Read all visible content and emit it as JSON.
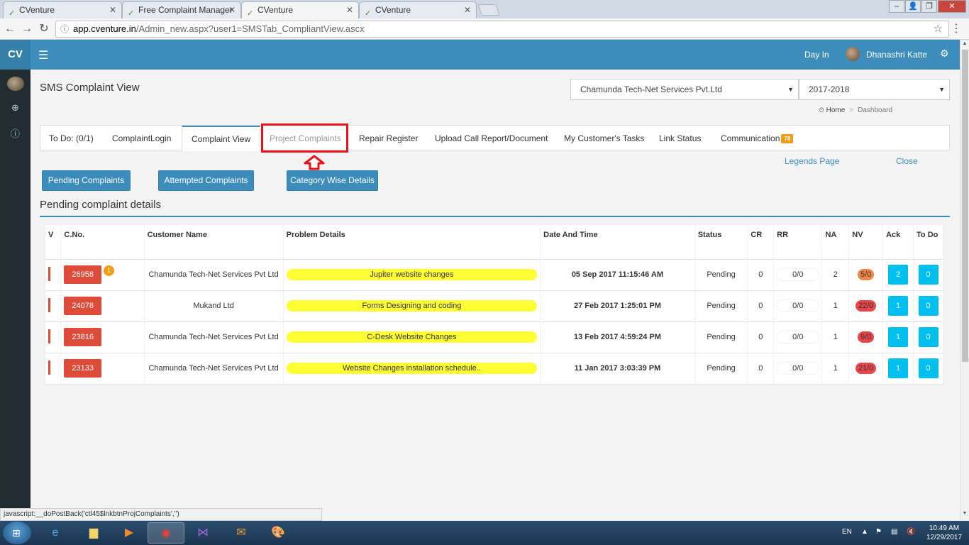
{
  "browser": {
    "tabs": [
      {
        "title": "CVenture"
      },
      {
        "title": "Free Complaint Manager"
      },
      {
        "title": "CVenture"
      },
      {
        "title": "CVenture"
      }
    ],
    "url_host": "app.cventure.in",
    "url_path": "/Admin_new.aspx?user1=SMSTab_CompliantView.ascx",
    "status_text": "javascript:__doPostBack('ctl45$lnkbtnProjComplaints','')"
  },
  "header": {
    "logo": "CV",
    "day_in": "Day In",
    "user_name": "Dhanashri Katte"
  },
  "page": {
    "title": "SMS Complaint View",
    "company_select": "Chamunda Tech-Net Services Pvt.Ltd",
    "year_select": "2017-2018",
    "breadcrumb": {
      "home": "Home",
      "current": "Dashboard"
    }
  },
  "tabs": [
    {
      "label": "To Do: (0/1)"
    },
    {
      "label": "ComplaintLogin"
    },
    {
      "label": "Complaint View"
    },
    {
      "label": "Project Complaints"
    },
    {
      "label": "Repair Register"
    },
    {
      "label": "Upload Call Report/Document"
    },
    {
      "label": "My Customer's Tasks"
    },
    {
      "label": "Link Status"
    },
    {
      "label": "Communication",
      "badge": "78"
    }
  ],
  "links": {
    "legends": "Legends Page",
    "close": "Close"
  },
  "buttons": {
    "pending": "Pending Complaints",
    "attempted": "Attempted Complaints",
    "category": "Category Wise Details"
  },
  "section_title": "Pending complaint details",
  "table": {
    "headers": [
      "V",
      "C.No.",
      "Customer Name",
      "Problem Details",
      "Date And Time",
      "Status",
      "CR",
      "RR",
      "NA",
      "NV",
      "Ack",
      "To Do"
    ],
    "rows": [
      {
        "cno": "26958",
        "badge": "1",
        "customer": "Chamunda Tech-Net Services Pvt Ltd",
        "problem": "Jupiter website changes",
        "datetime": "05 Sep 2017 11:15:46 AM",
        "status": "Pending",
        "cr": "0",
        "rr": "0/0",
        "na": "2",
        "nv": "5/0",
        "nv_color": "#f0884a",
        "ack": "2",
        "todo": "0"
      },
      {
        "cno": "24078",
        "badge": "",
        "customer": "Mukand Ltd",
        "problem": "Forms Designing and coding",
        "datetime": "27 Feb 2017 1:25:01 PM",
        "status": "Pending",
        "cr": "0",
        "rr": "0/0",
        "na": "1",
        "nv": "22/0",
        "nv_color": "#e8464a",
        "ack": "1",
        "todo": "0"
      },
      {
        "cno": "23816",
        "badge": "",
        "customer": "Chamunda Tech-Net Services Pvt Ltd",
        "problem": "C-Desk Website Changes",
        "datetime": "13 Feb 2017 4:59:24 PM",
        "status": "Pending",
        "cr": "0",
        "rr": "0/0",
        "na": "1",
        "nv": "9/0",
        "nv_color": "#e8464a",
        "ack": "1",
        "todo": "0"
      },
      {
        "cno": "23133",
        "badge": "",
        "customer": "Chamunda Tech-Net Services Pvt Ltd",
        "problem": "Website Changes installation schedule..",
        "datetime": "11 Jan 2017 3:03:39 PM",
        "status": "Pending",
        "cr": "0",
        "rr": "0/0",
        "na": "1",
        "nv": "21/0",
        "nv_color": "#e8464a",
        "ack": "1",
        "todo": "0"
      }
    ]
  },
  "taskbar": {
    "lang": "EN",
    "time": "10:49 AM",
    "date": "12/29/2017"
  },
  "colors": {
    "primary": "#3c8dbc",
    "danger": "#dd4b39",
    "highlight": "#e8141c",
    "problem_bg": "#ffff33",
    "ack_bg": "#00c0ef"
  }
}
